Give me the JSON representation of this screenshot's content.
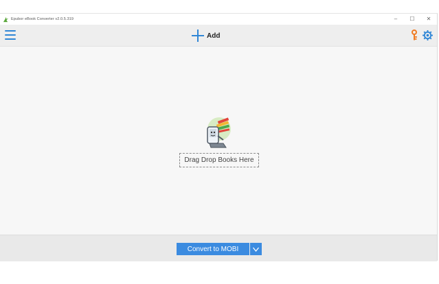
{
  "window": {
    "title": "Epubor eBook Converter v2.0.5.319",
    "controls": {
      "minimize": "–",
      "maximize": "☐",
      "close": "✕"
    }
  },
  "toolbar": {
    "menu_icon": "hamburger-menu-icon",
    "add_label": "Add",
    "add_icon": "plus-icon",
    "key_icon": "key-icon",
    "settings_icon": "gear-icon"
  },
  "content": {
    "drop_label": "Drag Drop Books Here",
    "illustration_icon": "books-icon"
  },
  "bottom": {
    "convert_label": "Convert to MOBI",
    "dropdown_icon": "chevron-down-icon"
  },
  "colors": {
    "accent": "#2f86d6",
    "button": "#3b8be0",
    "key": "#f07b22"
  }
}
